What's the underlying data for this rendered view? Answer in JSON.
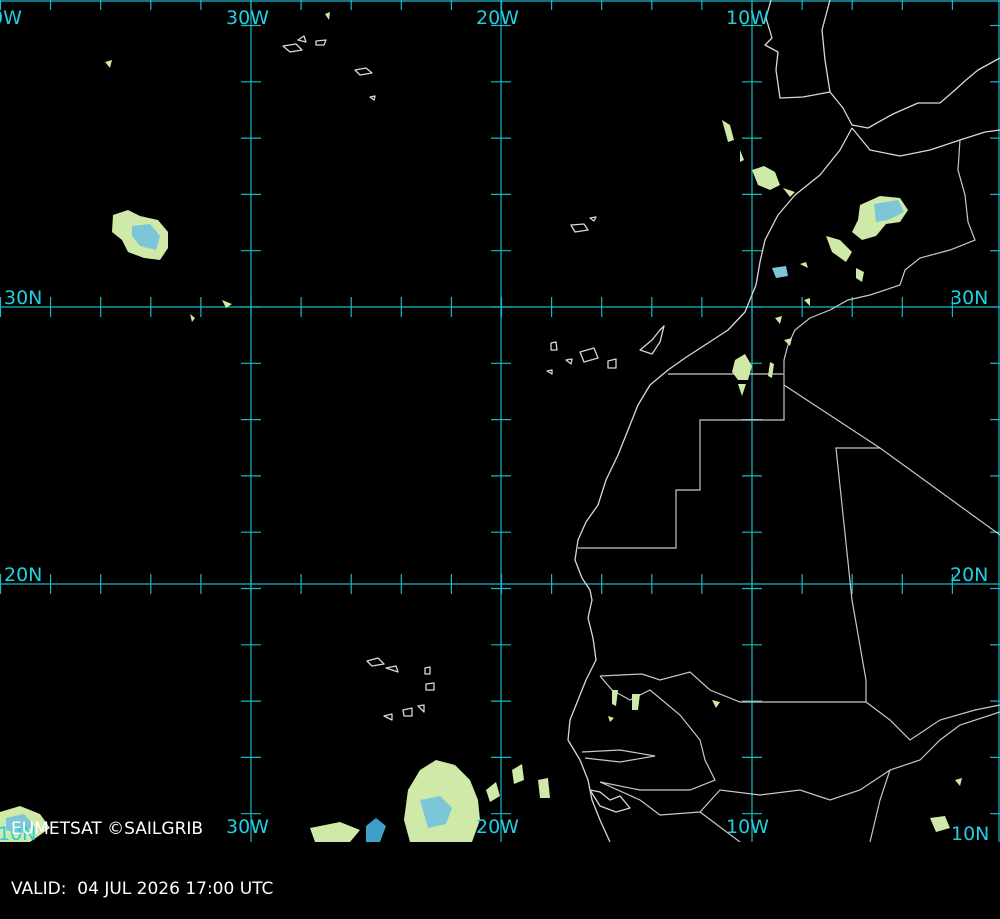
{
  "map": {
    "top_longitude_labels": [
      "0W",
      "30W",
      "20W",
      "10W"
    ],
    "bottom_longitude_labels": [
      "10N",
      "30W",
      "20W",
      "10W",
      "10N"
    ],
    "left_latitude_labels": [
      "30N",
      "20N"
    ],
    "right_latitude_labels": [
      "30N",
      "20N"
    ]
  },
  "credit": {
    "source": "EUMETSAT ©SAILGRIB",
    "valid": "VALID:  04 JUL 2026 17:00 UTC"
  },
  "colors": {
    "background": "#000000",
    "graticule": "#19b9c9",
    "coastline": "#d8d8d8",
    "cloud_light": "#cfe9a8",
    "cloud_mid": "#7cc6d8",
    "cloud_dark": "#3f9fc8"
  }
}
